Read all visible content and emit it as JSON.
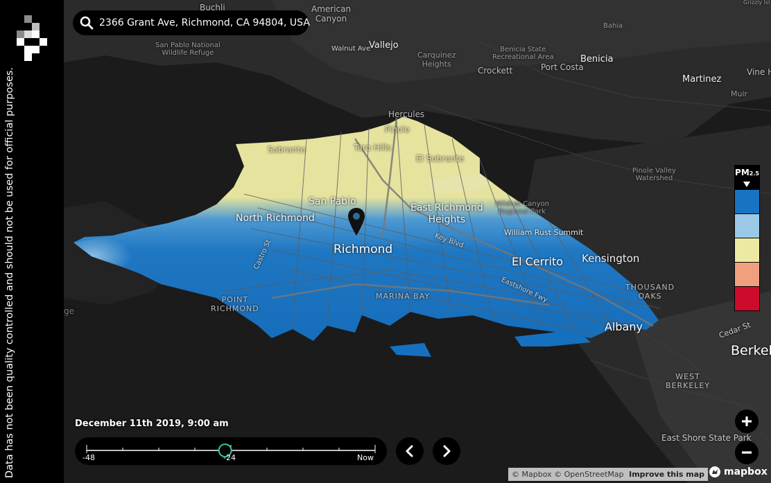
{
  "sidebar": {
    "disclaimer": "Data has not been quality controlled and should not be used for official purposes."
  },
  "search": {
    "value": "2366 Grant Ave, Richmond, CA 94804, USA",
    "icon": "search-icon"
  },
  "map_labels": {
    "buchli": "Buchli",
    "american_canyon": "American\nCanyon",
    "bahia": "Bahia",
    "san_pablo_refuge": "San Pablo National\nWildlife Refuge",
    "walnut_ave": "Walnut Ave",
    "vallejo": "Vallejo",
    "carquinez_heights": "Carquinez\nHeights",
    "benicia_state": "Benicia State\nRecreational Area",
    "crockett": "Crockett",
    "port_costa": "Port Costa",
    "benicia": "Benicia",
    "martinez": "Martinez",
    "muir": "Muir",
    "vine_hill": "Vine H",
    "grizzly": "Grizzly Isl",
    "hercules": "Hercules",
    "pinole": "Pinole",
    "sobrante": "Sobrante",
    "tara_hills": "Tara Hills",
    "el_sobrante": "El Sobrante",
    "pinole_valley": "Pinole Valley\nWatershed",
    "san_pablo": "San Pablo",
    "east_richmond_heights": "East Richmond\nHeights",
    "wildcat_canyon": "Wildcat Canyon\nRegional Park",
    "north_richmond": "North Richmond",
    "william_rust": "William Rust Summit",
    "richmond": "Richmond",
    "key_blvd": "Key Blvd",
    "castro_st": "Castro St",
    "el_cerrito": "El Cerrito",
    "kensington": "Kensington",
    "thousand_oaks": "THOUSAND\nOAKS",
    "eastshore_fwy": "Eastshore Fwy",
    "marina_bay": "MARINA BAY",
    "point_richmond": "POINT\nRICHMOND",
    "ge": "ge",
    "albany": "Albany",
    "cedar_st": "Cedar St",
    "berkeley": "Berkel",
    "west_berkeley": "WEST\nBERKELEY",
    "east_shore_park": "East Shore State Park"
  },
  "legend": {
    "title": "PM",
    "subscript": "2.5",
    "colors": [
      "#1874c2",
      "#9ac8e6",
      "#ece9a2",
      "#f1a07f",
      "#cd0b2c"
    ]
  },
  "timeline": {
    "date_label": "December 11th 2019, 9:00 am",
    "start_label": "-48",
    "mid_label": "-24",
    "end_label": "Now",
    "position_fraction": 0.48,
    "accent": "#2fc6a9"
  },
  "controls": {
    "prev_icon": "chevron-left-icon",
    "next_icon": "chevron-right-icon",
    "zoom_in_icon": "plus-icon",
    "zoom_out_icon": "minus-icon"
  },
  "attribution": {
    "mapbox": "© Mapbox",
    "osm": "© OpenStreetMap",
    "improve": "Improve this map",
    "logo_text": "mapbox"
  }
}
